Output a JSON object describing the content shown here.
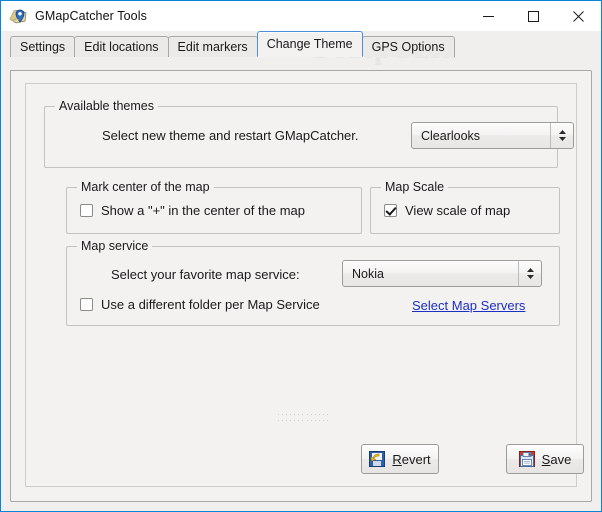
{
  "window": {
    "title": "GMapCatcher Tools",
    "icon": "map-marker-icon",
    "accent_color": "#0a84d8",
    "controls": {
      "minimize": "minimize-icon",
      "maximize": "maximize-icon",
      "close": "close-icon"
    }
  },
  "watermark": {
    "text": "Softpedia"
  },
  "tabs": [
    {
      "label": "Settings",
      "active": false
    },
    {
      "label": "Edit locations",
      "active": false
    },
    {
      "label": "Edit markers",
      "active": false
    },
    {
      "label": "Change Theme",
      "active": true
    },
    {
      "label": "GPS Options",
      "active": false
    }
  ],
  "groups": {
    "available_themes": {
      "title": "Available themes",
      "description": "Select new theme and restart GMapCatcher.",
      "theme_combo": {
        "value": "Clearlooks",
        "arrow_icon": "updown-chevron-icon"
      }
    },
    "mark_center": {
      "title": "Mark center of the map",
      "checkbox": {
        "label": "Show a \"+\" in the center of the map",
        "checked": false
      }
    },
    "map_scale": {
      "title": "Map Scale",
      "checkbox": {
        "label": "View scale of map",
        "checked": true
      }
    },
    "map_service": {
      "title": "Map service",
      "service_label": "Select your favorite map service:",
      "service_combo": {
        "value": "Nokia",
        "arrow_icon": "updown-chevron-icon"
      },
      "folder_checkbox": {
        "label": "Use a different folder per Map Service",
        "checked": false
      },
      "servers_link": {
        "text": "Select Map Servers",
        "color": "#1c2fc4"
      }
    }
  },
  "buttons": {
    "revert": {
      "label_pre": "",
      "mnemonic": "R",
      "label_post": "evert",
      "icon": "revert-icon"
    },
    "save": {
      "label_pre": "",
      "mnemonic": "S",
      "label_post": "ave",
      "icon": "floppy-save-icon"
    }
  }
}
